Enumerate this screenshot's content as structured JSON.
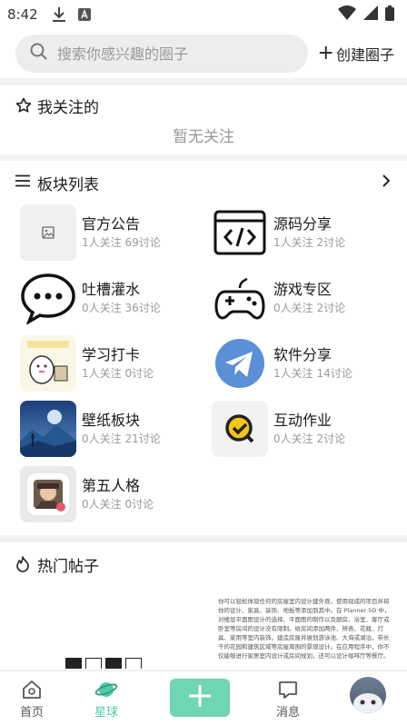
{
  "status_bar": {
    "time": "8:42"
  },
  "search": {
    "placeholder": "搜索你感兴趣的圈子",
    "create_label": "创建圈子"
  },
  "follow_section": {
    "title": "我关注的",
    "empty_text": "暂无关注"
  },
  "boards_section": {
    "title": "板块列表",
    "items": [
      {
        "name": "官方公告",
        "meta": "1人关注 69讨论",
        "icon": "image-placeholder-icon"
      },
      {
        "name": "源码分享",
        "meta": "1人关注 2讨论",
        "icon": "code-icon"
      },
      {
        "name": "吐槽灌水",
        "meta": "0人关注 36讨论",
        "icon": "chat-bubble-icon"
      },
      {
        "name": "游戏专区",
        "meta": "0人关注 2讨论",
        "icon": "gamepad-icon"
      },
      {
        "name": "学习打卡",
        "meta": "1人关注 0讨论",
        "icon": "study-sticker-icon"
      },
      {
        "name": "软件分享",
        "meta": "1人关注 14讨论",
        "icon": "paper-plane-icon"
      },
      {
        "name": "壁纸板块",
        "meta": "0人关注 21讨论",
        "icon": "wallpaper-landscape-icon"
      },
      {
        "name": "互动作业",
        "meta": "0人关注 2讨论",
        "icon": "q-check-icon"
      },
      {
        "name": "第五人格",
        "meta": "0人关注 0讨论",
        "icon": "game-character-icon"
      }
    ]
  },
  "hot_section": {
    "title": "热门帖子",
    "post_preview_text": "你可以轻松体现任何的房屋室内设计建外观，使用现成的项目并将你的设计、家具、装饰、地板等添加到其中。在 Planner 5D 中，对楼层平面图设计的选择、平面图的制作以及厨房、浴室、客厅或卧室等房间的设计没有限制。给房间添加两件、辨表、花瓶、灯具、家用等室内装饰。建造房屋并展划游泳池、大海或湖泊，带长干的花园和建筑区域等房屋周围的景观设计。在应用程序中，你不仅能够进行家居室内设计或房间规划，还可以设计咖啡厅等餐厅。"
  },
  "tab_bar": {
    "tabs": [
      {
        "label": "首页",
        "icon": "home-icon"
      },
      {
        "label": "星球",
        "icon": "planet-icon",
        "active": true
      },
      {
        "label": "",
        "icon": "plus-icon"
      },
      {
        "label": "消息",
        "icon": "message-icon"
      },
      {
        "label": "",
        "icon": "avatar"
      }
    ]
  },
  "colors": {
    "accent": "#4ecaa9",
    "add_button": "#6fd5b4",
    "muted_text": "#9a9a9a"
  }
}
